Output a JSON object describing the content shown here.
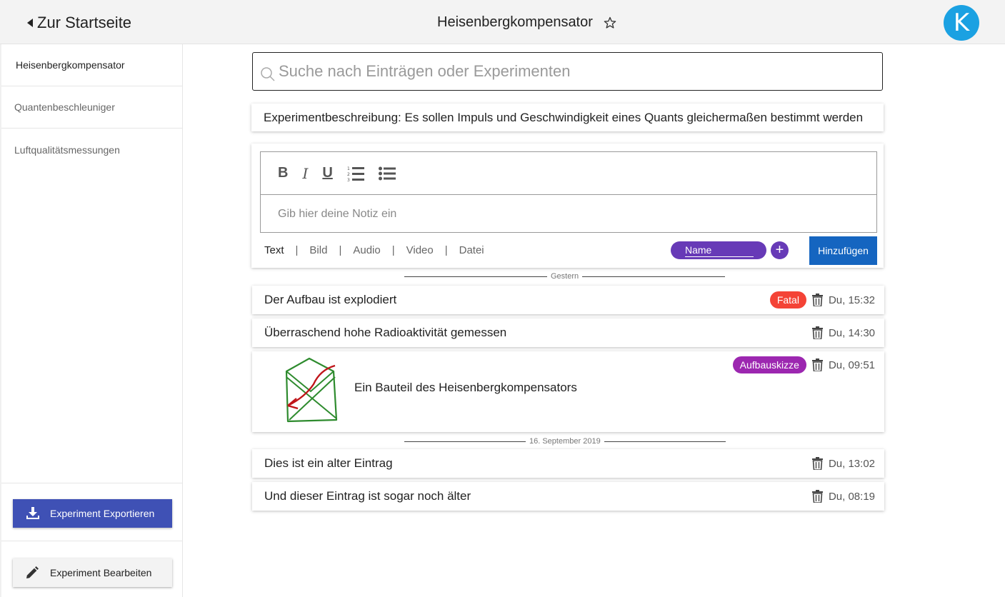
{
  "header": {
    "back_label": "Zur Startseite",
    "title": "Heisenbergkompensator",
    "logo_letter": "K"
  },
  "sidebar": {
    "items": [
      {
        "label": "Heisenbergkompensator",
        "active": true
      },
      {
        "label": "Quantenbeschleuniger",
        "active": false
      },
      {
        "label": "Luftqualitätsmessungen",
        "active": false
      }
    ],
    "export_label": "Experiment Exportieren",
    "edit_label": "Experiment Bearbeiten"
  },
  "search": {
    "placeholder": "Suche nach Einträgen oder Experimenten"
  },
  "description": "Experimentbeschreibung: Es sollen Impuls und Geschwindigkeit eines Quants gleichermaßen bestimmt werden",
  "editor": {
    "toolbar": {
      "bold": "B",
      "italic": "I",
      "underline": "U"
    },
    "placeholder": "Gib hier deine Notiz ein",
    "types": [
      "Text",
      "Bild",
      "Audio",
      "Video",
      "Datei"
    ],
    "active_type": "Text",
    "name_label": "Name",
    "add_label": "Hinzufügen"
  },
  "groups": [
    {
      "label": "Gestern",
      "entries": [
        {
          "text": "Der Aufbau ist explodiert",
          "badge": "Fatal",
          "badge_color": "#f44336",
          "time": "Du, 15:32"
        },
        {
          "text": "Überraschend hohe Radioaktivität gemessen",
          "badge": "",
          "time": "Du, 14:30"
        },
        {
          "text": "Ein Bauteil des Heisenbergkompensators",
          "badge": "Aufbauskizze",
          "badge_color": "#9c27b0",
          "time": "Du, 09:51",
          "image": "sketch"
        }
      ]
    },
    {
      "label": "16. September 2019",
      "entries": [
        {
          "text": "Dies ist ein alter Eintrag",
          "badge": "",
          "time": "Du, 13:02"
        },
        {
          "text": "Und dieser Eintrag ist sogar noch älter",
          "badge": "",
          "time": "Du, 08:19"
        }
      ]
    }
  ],
  "colors": {
    "accent_purple": "#673ab7",
    "export_blue": "#3f51b5",
    "add_blue": "#1565c0",
    "logo_blue": "#1ba1e2"
  },
  "icons": [
    "chevron-left-icon",
    "star-icon",
    "search-icon",
    "download-icon",
    "pencil-icon",
    "ordered-list-icon",
    "unordered-list-icon",
    "plus-icon",
    "trash-icon"
  ]
}
